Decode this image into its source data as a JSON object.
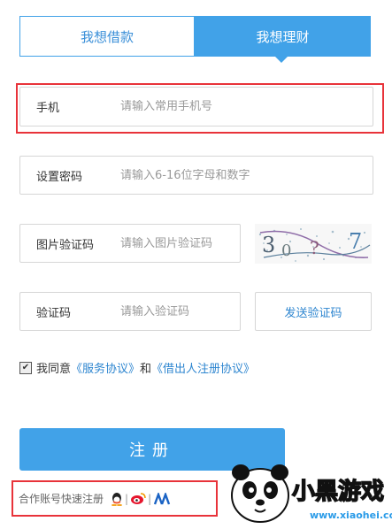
{
  "tabs": [
    {
      "label": "我想借款",
      "active": false
    },
    {
      "label": "我想理财",
      "active": true
    }
  ],
  "form": {
    "phone": {
      "label": "手机",
      "placeholder": "请输入常用手机号"
    },
    "password": {
      "label": "设置密码",
      "placeholder": "请输入6-16位字母和数字"
    },
    "image_code": {
      "label": "图片验证码",
      "placeholder": "请输入图片验证码"
    },
    "sms_code": {
      "label": "验证码",
      "placeholder": "请输入验证码"
    },
    "send_code_label": "发送验证码"
  },
  "captcha": {
    "text": "30?7"
  },
  "agreement": {
    "checked": true,
    "prefix": "我同意",
    "service_link": "《服务协议》",
    "conjunction": "和",
    "borrower_link": "《借出人注册协议》"
  },
  "register_label": "注册",
  "social": {
    "label": "合作账号快速注册",
    "icons": [
      "qq-icon",
      "weibo-icon",
      "renren-icon"
    ]
  },
  "watermark": {
    "text": "www.xiaohei.com"
  },
  "colors": {
    "accent": "#41a2e8",
    "link": "#2e86d0",
    "highlight": "#e8333a"
  }
}
